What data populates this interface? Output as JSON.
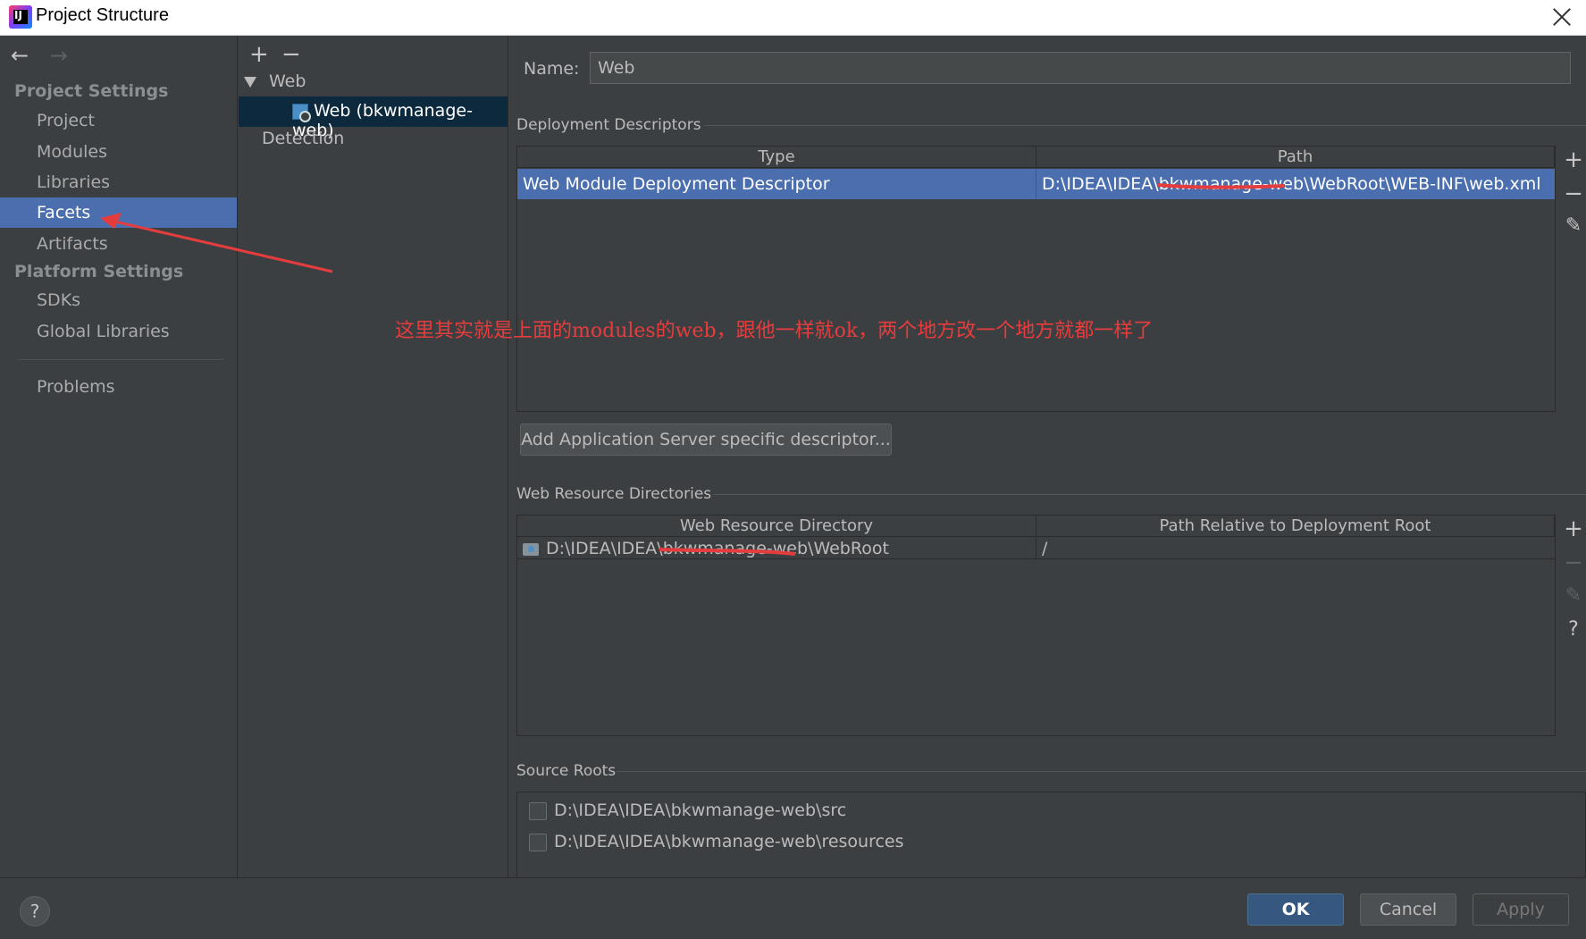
{
  "window": {
    "title": "Project Structure",
    "app_icon_text": "IJ"
  },
  "nav": {
    "back_icon": "←",
    "forward_icon": "→",
    "project_settings_header": "Project Settings",
    "project_items": [
      "Project",
      "Modules",
      "Libraries",
      "Facets",
      "Artifacts"
    ],
    "selected": "Facets",
    "platform_settings_header": "Platform Settings",
    "platform_items": [
      "SDKs",
      "Global Libraries"
    ],
    "problems": "Problems"
  },
  "tree": {
    "add_icon": "+",
    "remove_icon": "−",
    "root": "Web",
    "child": "Web (bkwmanage-web)",
    "detection": "Detection"
  },
  "facet": {
    "name_label": "Name:",
    "name_value": "Web",
    "deployment_section": "Deployment Descriptors",
    "deployment_columns": [
      "Type",
      "Path"
    ],
    "deployment_rows": [
      {
        "type": "Web Module Deployment Descriptor",
        "path": "D:\\IDEA\\IDEA\\bkwmanage-web\\WebRoot\\WEB-INF\\web.xml"
      }
    ],
    "add_server_descriptor_button": "Add Application Server specific descriptor...",
    "web_resource_section": "Web Resource Directories",
    "web_resource_columns": [
      "Web Resource Directory",
      "Path Relative to Deployment Root"
    ],
    "web_resource_rows": [
      {
        "directory": "D:\\IDEA\\IDEA\\bkwmanage-web\\WebRoot",
        "relative": "/"
      }
    ],
    "source_roots_section": "Source Roots",
    "source_roots": [
      {
        "path": "D:\\IDEA\\IDEA\\bkwmanage-web\\src",
        "checked": false
      },
      {
        "path": "D:\\IDEA\\IDEA\\bkwmanage-web\\resources",
        "checked": false
      }
    ],
    "side_tools": {
      "add": "+",
      "remove": "−",
      "edit": "✎",
      "help": "?"
    }
  },
  "annotation": {
    "text": "这里其实就是上面的modules的web，跟他一样就ok，两个地方改一个地方就都一样了",
    "color": "#e53d3d"
  },
  "buttons": {
    "help": "?",
    "ok": "OK",
    "cancel": "Cancel",
    "apply": "Apply"
  }
}
